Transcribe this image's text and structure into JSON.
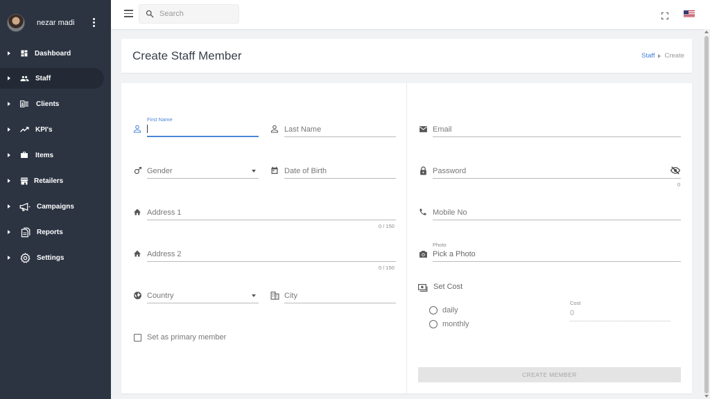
{
  "user": {
    "name": "nezar madi"
  },
  "sidebar": {
    "items": [
      {
        "label": "Dashboard",
        "icon": "dashboard-icon"
      },
      {
        "label": "Staff",
        "icon": "people-icon",
        "active": true
      },
      {
        "label": "Clients",
        "icon": "contacts-icon"
      },
      {
        "label": "KPI's",
        "icon": "trending-up-icon"
      },
      {
        "label": "Items",
        "icon": "briefcase-icon"
      },
      {
        "label": "Retailers",
        "icon": "store-icon"
      },
      {
        "label": "Campaigns",
        "icon": "megaphone-icon"
      },
      {
        "label": "Reports",
        "icon": "documents-icon"
      },
      {
        "label": "Settings",
        "icon": "gear-icon"
      }
    ]
  },
  "topbar": {
    "search_placeholder": "Search"
  },
  "header": {
    "title": "Create Staff Member",
    "breadcrumb": {
      "parent": "Staff",
      "current": "Create"
    }
  },
  "form": {
    "first_name": {
      "label": "First Name",
      "value": ""
    },
    "last_name": {
      "label": "Last Name"
    },
    "gender": {
      "label": "Gender"
    },
    "dob": {
      "label": "Date of Birth"
    },
    "address1": {
      "label": "Address 1",
      "counter": "0 / 150"
    },
    "address2": {
      "label": "Address 2",
      "counter": "0 / 150"
    },
    "country": {
      "label": "Country"
    },
    "city": {
      "label": "City"
    },
    "primary_member": {
      "label": "Set as primary member",
      "checked": false
    },
    "email": {
      "label": "Email"
    },
    "password": {
      "label": "Password",
      "counter": "0"
    },
    "mobile": {
      "label": "Mobile No"
    },
    "photo": {
      "label": "Photo",
      "placeholder": "Pick a Photo"
    },
    "set_cost": {
      "label": "Set Cost",
      "options": [
        "daily",
        "monthly"
      ]
    },
    "cost": {
      "label": "Cost",
      "value": "0"
    },
    "submit_label": "CREATE MEMBER"
  },
  "colors": {
    "sidebar_bg": "#2c3442",
    "sidebar_active": "#232a36",
    "accent": "#4b86d6",
    "page_bg": "#f1f2f4"
  }
}
